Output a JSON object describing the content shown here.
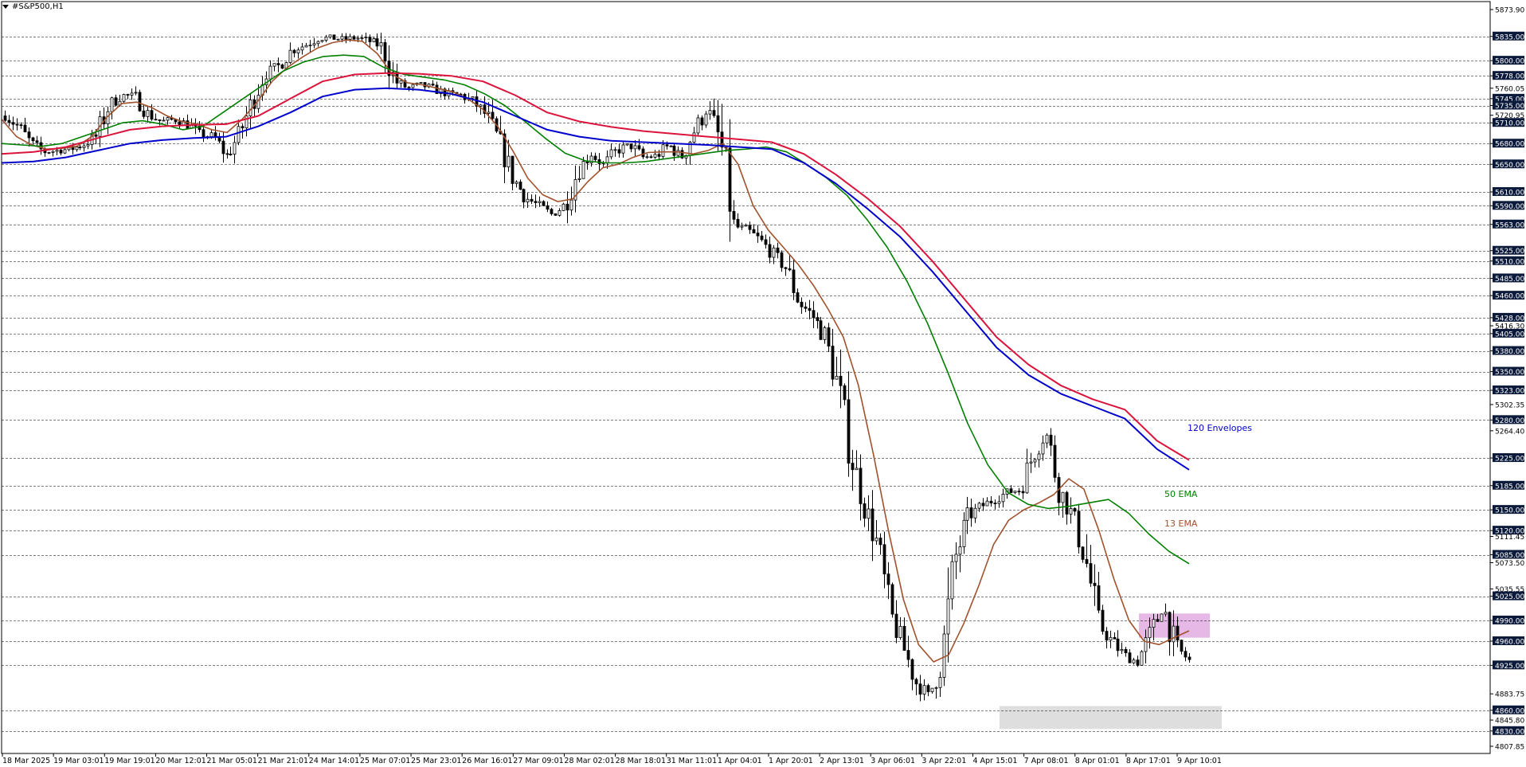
{
  "window": {
    "title": "#S&P500,H1"
  },
  "chart_data": {
    "type": "candlestick",
    "symbol": "#S&P500",
    "timeframe": "H1",
    "ylim": [
      4807.85,
      5873.9
    ],
    "y_axis_labels": [
      "5873.90",
      "5835.00",
      "5800.00",
      "5778.00",
      "5760.05",
      "5745.00",
      "5735.00",
      "5720.95",
      "5710.00",
      "5680.00",
      "5650.00",
      "5610.00",
      "5590.00",
      "5563.00",
      "5525.00",
      "5510.00",
      "5485.00",
      "5460.00",
      "5428.00",
      "5416.30",
      "5405.00",
      "5380.00",
      "5350.00",
      "5323.00",
      "5302.35",
      "5280.00",
      "5264.40",
      "5225.00",
      "5185.00",
      "5150.00",
      "5120.00",
      "5111.45",
      "5085.00",
      "5073.50",
      "5035.55",
      "5025.00",
      "4990.00",
      "4960.00",
      "4925.00",
      "4883.75",
      "4860.00",
      "4845.80",
      "4830.00",
      "4807.85"
    ],
    "horizontal_levels": [
      5835.0,
      5800.0,
      5778.0,
      5745.0,
      5735.0,
      5710.0,
      5680.0,
      5650.0,
      5610.0,
      5590.0,
      5563.0,
      5525.0,
      5510.0,
      5485.0,
      5460.0,
      5428.0,
      5405.0,
      5380.0,
      5350.0,
      5323.0,
      5280.0,
      5225.0,
      5185.0,
      5150.0,
      5120.0,
      5085.0,
      5025.0,
      4990.0,
      4960.0,
      4925.0,
      4860.0,
      4830.0
    ],
    "x_axis_labels": [
      "18 Mar 2025",
      "19 Mar 03:01",
      "19 Mar 19:01",
      "20 Mar 12:01",
      "21 Mar 05:01",
      "21 Mar 21:01",
      "24 Mar 14:01",
      "25 Mar 07:01",
      "25 Mar 23:01",
      "26 Mar 16:01",
      "27 Mar 09:01",
      "28 Mar 02:01",
      "28 Mar 18:01",
      "31 Mar 11:01",
      "1 Apr 04:01",
      "1 Apr 20:01",
      "2 Apr 13:01",
      "3 Apr 06:01",
      "3 Apr 22:01",
      "4 Apr 15:01",
      "7 Apr 08:01",
      "8 Apr 01:01",
      "8 Apr 17:01",
      "9 Apr 10:01"
    ],
    "price_path": [
      5720,
      5705,
      5680,
      5668,
      5670,
      5672,
      5678,
      5690,
      5735,
      5750,
      5748,
      5722,
      5712,
      5715,
      5708,
      5692,
      5690,
      5662,
      5692,
      5740,
      5782,
      5792,
      5815,
      5822,
      5832,
      5833,
      5831,
      5833,
      5828,
      5820,
      5770,
      5760,
      5765,
      5758,
      5752,
      5750,
      5740,
      5720,
      5680,
      5630,
      5602,
      5590,
      5578,
      5590,
      5640,
      5665,
      5650,
      5670,
      5678,
      5660,
      5662,
      5678,
      5660,
      5700,
      5730,
      5680,
      5560,
      5555,
      5540,
      5520,
      5500,
      5450,
      5432,
      5400,
      5330,
      5230,
      5160,
      5100,
      5000,
      4952,
      4900,
      4880,
      4940,
      5080,
      5140,
      5155,
      5165,
      5175,
      5180,
      5230,
      5260,
      5180,
      5140,
      5080,
      4985,
      4960,
      4940,
      4930,
      4970,
      5010,
      4950,
      4932
    ],
    "series": [
      {
        "name": "13 EMA",
        "color": "#a0522d",
        "values": [
          5715,
          5690,
          5678,
          5672,
          5673,
          5676,
          5690,
          5718,
          5738,
          5740,
          5732,
          5720,
          5712,
          5708,
          5700,
          5696,
          5715,
          5740,
          5770,
          5790,
          5805,
          5818,
          5826,
          5830,
          5828,
          5810,
          5780,
          5768,
          5765,
          5760,
          5755,
          5745,
          5730,
          5705,
          5670,
          5630,
          5606,
          5596,
          5600,
          5625,
          5645,
          5650,
          5660,
          5667,
          5668,
          5668,
          5665,
          5670,
          5680,
          5650,
          5590,
          5555,
          5530,
          5505,
          5475,
          5440,
          5400,
          5330,
          5230,
          5120,
          5020,
          4955,
          4930,
          4940,
          4985,
          5040,
          5100,
          5135,
          5150,
          5160,
          5172,
          5195,
          5180,
          5120,
          5050,
          4990,
          4960,
          4955,
          4965,
          4975
        ]
      },
      {
        "name": "50 EMA",
        "color": "#008000",
        "values": [
          5680,
          5678,
          5676,
          5680,
          5690,
          5700,
          5710,
          5713,
          5708,
          5700,
          5705,
          5725,
          5745,
          5765,
          5785,
          5798,
          5806,
          5808,
          5806,
          5790,
          5780,
          5776,
          5772,
          5765,
          5752,
          5735,
          5712,
          5688,
          5666,
          5655,
          5652,
          5652,
          5654,
          5658,
          5662,
          5666,
          5670,
          5672,
          5675,
          5668,
          5650,
          5630,
          5605,
          5570,
          5530,
          5480,
          5420,
          5350,
          5275,
          5215,
          5175,
          5158,
          5152,
          5155,
          5160,
          5165,
          5145,
          5115,
          5090,
          5072
        ]
      },
      {
        "name": "120 Envelopes upper",
        "color": "#dc143c",
        "values": [
          5665,
          5668,
          5675,
          5688,
          5700,
          5705,
          5707,
          5708,
          5720,
          5745,
          5770,
          5780,
          5782,
          5781,
          5778,
          5770,
          5750,
          5725,
          5712,
          5704,
          5698,
          5694,
          5690,
          5686,
          5682,
          5665,
          5635,
          5600,
          5560,
          5510,
          5455,
          5400,
          5360,
          5330,
          5310,
          5295,
          5250,
          5222
        ]
      },
      {
        "name": "120 Envelopes lower",
        "color": "#0000cd",
        "values": [
          5652,
          5654,
          5660,
          5670,
          5680,
          5685,
          5688,
          5690,
          5705,
          5725,
          5748,
          5758,
          5760,
          5758,
          5752,
          5740,
          5720,
          5700,
          5690,
          5684,
          5682,
          5680,
          5678,
          5675,
          5672,
          5652,
          5622,
          5585,
          5545,
          5495,
          5440,
          5385,
          5345,
          5318,
          5300,
          5282,
          5238,
          5208
        ]
      }
    ],
    "annotations": [
      {
        "text": "120 Envelopes",
        "color": "#0000cd"
      },
      {
        "text": "50 EMA",
        "color": "#008000"
      },
      {
        "text": "13 EMA",
        "color": "#a0522d"
      }
    ],
    "zones": [
      {
        "kind": "resistance",
        "color": "#dda0dd",
        "y_range": [
          4965,
          5000
        ]
      },
      {
        "kind": "support",
        "color": "#d3d3d3",
        "y_range": [
          4833,
          4866
        ]
      }
    ]
  }
}
